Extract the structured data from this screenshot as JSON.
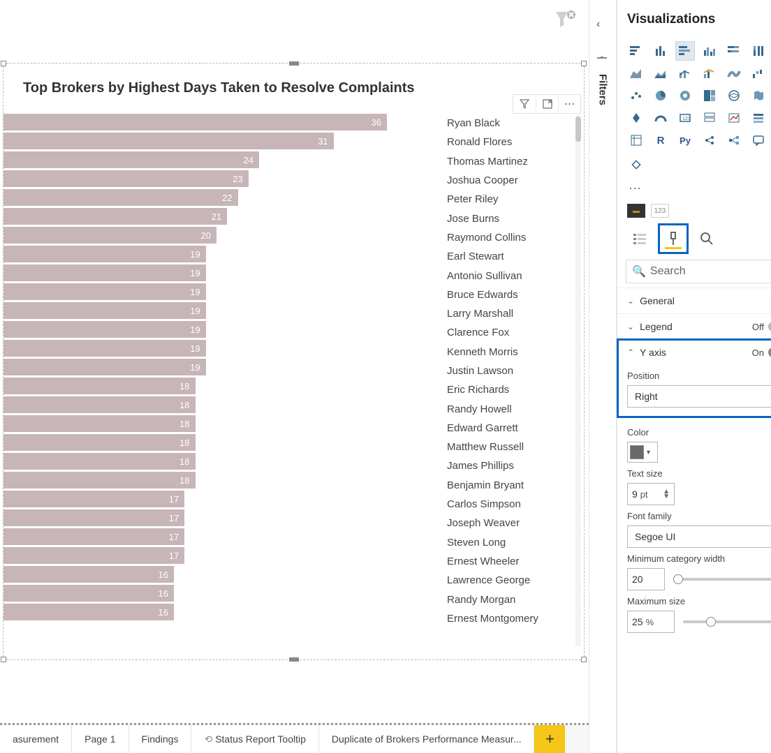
{
  "chart_data": {
    "type": "bar",
    "orientation": "horizontal",
    "title": "Top Brokers by Highest Days Taken to Resolve Complaints",
    "xlabel": "",
    "ylabel": "",
    "xlim": [
      0,
      40
    ],
    "bar_color": "#c7b5b8",
    "categories": [
      "Ryan Black",
      "Ronald Flores",
      "Thomas Martinez",
      "Joshua Cooper",
      "Peter Riley",
      "Jose Burns",
      "Raymond Collins",
      "Earl Stewart",
      "Antonio Sullivan",
      "Bruce Edwards",
      "Larry Marshall",
      "Clarence Fox",
      "Kenneth Morris",
      "Justin Lawson",
      "Eric Richards",
      "Randy Howell",
      "Edward Garrett",
      "Matthew Russell",
      "James Phillips",
      "Benjamin Bryant",
      "Carlos Simpson",
      "Joseph Weaver",
      "Steven Long",
      "Ernest Wheeler",
      "Lawrence George",
      "Randy Morgan",
      "Ernest Montgomery"
    ],
    "values": [
      36,
      31,
      24,
      23,
      22,
      21,
      20,
      19,
      19,
      19,
      19,
      19,
      19,
      19,
      18,
      18,
      18,
      18,
      18,
      18,
      17,
      17,
      17,
      17,
      16,
      16,
      16
    ]
  },
  "visual_actions": {
    "filter": "filter-icon",
    "focus": "focus-mode-icon",
    "more": "⋯"
  },
  "tabs": {
    "items": [
      "asurement",
      "Page 1",
      "Findings",
      "Status Report Tooltip",
      "Duplicate of Brokers Performance Measur..."
    ],
    "tooltip_tab_index": 3,
    "add_label": "+"
  },
  "filters_rail": {
    "label": "Filters"
  },
  "viz_pane": {
    "title": "Visualizations",
    "more": "···",
    "field_well_value": "123",
    "search_placeholder": "Search",
    "sections": {
      "general": {
        "label": "General"
      },
      "legend": {
        "label": "Legend",
        "state": "Off"
      },
      "yaxis": {
        "label": "Y axis",
        "state": "On"
      }
    },
    "yaxis_props": {
      "position_label": "Position",
      "position_value": "Right",
      "color_label": "Color",
      "color_value": "#6a6a6a",
      "text_size_label": "Text size",
      "text_size_value": "9",
      "text_size_unit": "pt",
      "font_family_label": "Font family",
      "font_family_value": "Segoe UI",
      "min_cat_width_label": "Minimum category width",
      "min_cat_width_value": "20",
      "max_size_label": "Maximum size",
      "max_size_value": "25",
      "max_size_unit": "%"
    }
  }
}
